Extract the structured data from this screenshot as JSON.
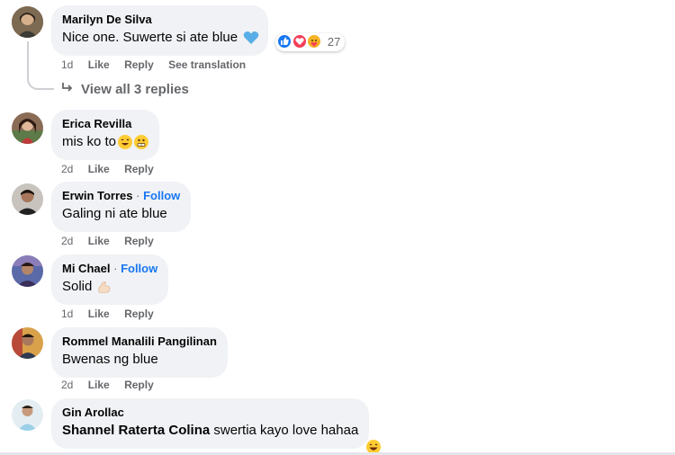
{
  "comments": [
    {
      "name": "Marilyn De Silva",
      "text": "Nice one. Suwerte si ate blue",
      "emoji": "blue-heart-icon",
      "reaction_count": "27",
      "time": "1d",
      "like": "Like",
      "reply": "Reply",
      "translate": "See translation",
      "view_replies": "View all 3 replies"
    },
    {
      "name": "Erica Revilla",
      "text": "mis ko to",
      "time": "2d",
      "like": "Like",
      "reply": "Reply"
    },
    {
      "name": "Erwin Torres",
      "follow": "Follow",
      "text": "Galing ni ate blue",
      "time": "2d",
      "like": "Like",
      "reply": "Reply"
    },
    {
      "name": "Mi Chael",
      "follow": "Follow",
      "text": "Solid",
      "time": "1d",
      "like": "Like",
      "reply": "Reply"
    },
    {
      "name": "Rommel Manalili Pangilinan",
      "text": "Bwenas ng blue",
      "time": "2d",
      "like": "Like",
      "reply": "Reply"
    },
    {
      "name": "Gin Arollac",
      "tag": "Shannel Raterta Colina",
      "text": " swertia kayo love hahaa"
    }
  ],
  "colors": {
    "bubble": "#f0f2f5",
    "meta": "#65676b",
    "link": "#1877f2"
  }
}
